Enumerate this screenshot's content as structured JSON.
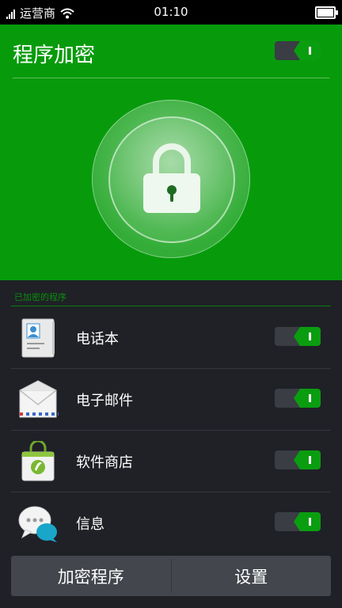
{
  "status_bar": {
    "carrier": "运营商",
    "time": "01:10"
  },
  "header": {
    "title": "程序加密",
    "toggle_on": true
  },
  "section": {
    "title": "已加密的程序"
  },
  "apps": [
    {
      "label": "电话本",
      "icon": "contacts-icon",
      "locked": true
    },
    {
      "label": "电子邮件",
      "icon": "email-icon",
      "locked": true
    },
    {
      "label": "软件商店",
      "icon": "app-store-icon",
      "locked": true
    },
    {
      "label": "信息",
      "icon": "messages-icon",
      "locked": true
    }
  ],
  "bottom": {
    "encrypt_label": "加密程序",
    "settings_label": "设置"
  },
  "colors": {
    "accent": "#079b0c",
    "background": "#1f2126"
  }
}
